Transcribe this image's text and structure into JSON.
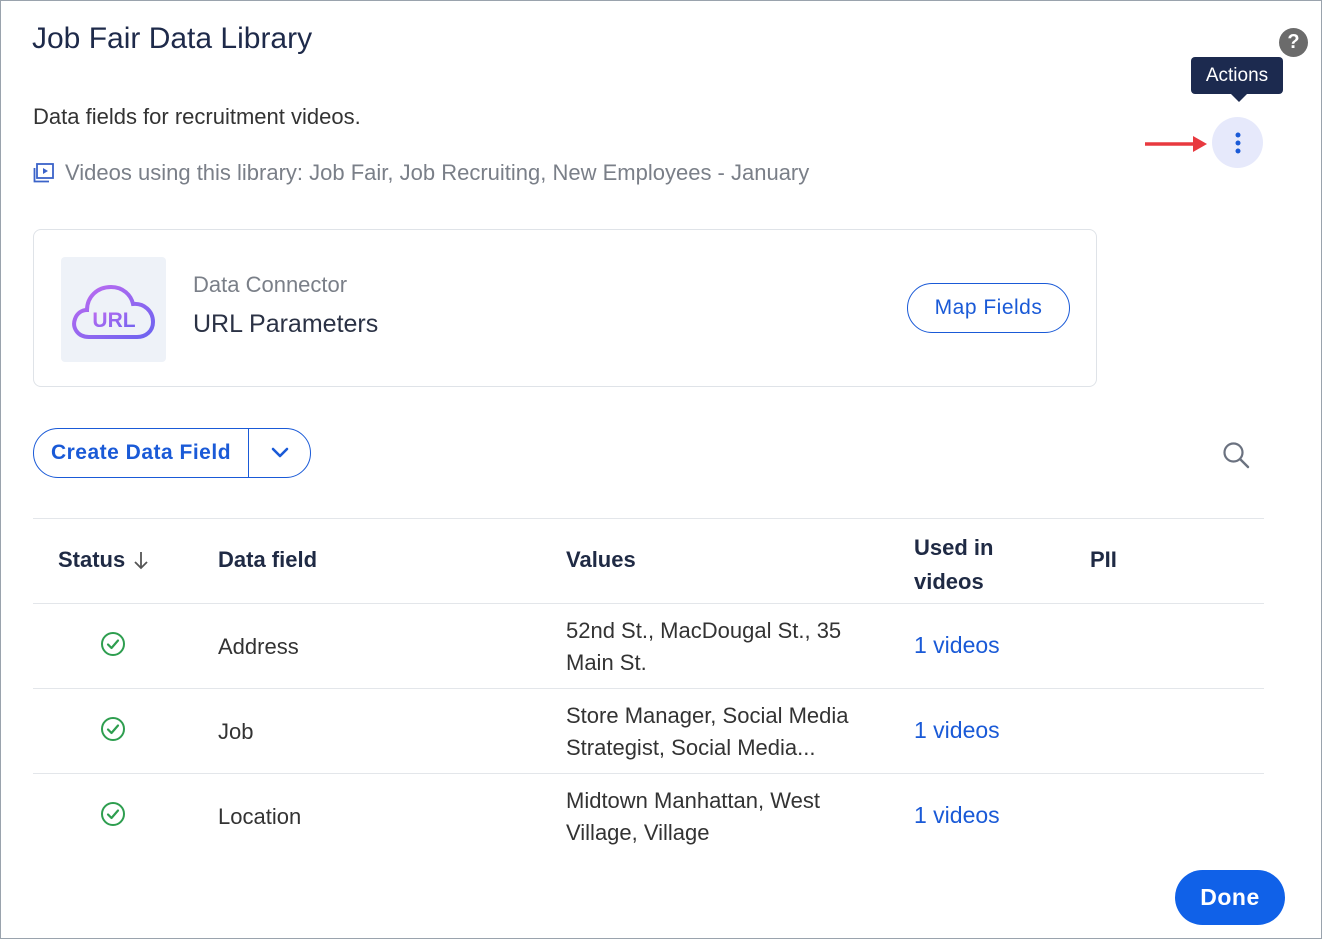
{
  "dialog": {
    "title": "Job Fair Data Library",
    "description": "Data fields for recruitment videos.",
    "videos_using": "Videos using this library: Job Fair, Job Recruiting, New Employees - January"
  },
  "help": {
    "glyph": "?"
  },
  "actions": {
    "tooltip": "Actions"
  },
  "connector": {
    "label": "Data Connector",
    "name": "URL Parameters",
    "logo_text": "URL",
    "map_fields_label": "Map Fields"
  },
  "toolbar": {
    "create_label": "Create Data Field"
  },
  "table": {
    "headers": {
      "status": "Status",
      "data_field": "Data field",
      "values": "Values",
      "used_in_line1": "Used in",
      "used_in_line2": "videos",
      "pii": "PII"
    },
    "rows": [
      {
        "field": "Address",
        "values": "52nd St., MacDougal St., 35 Main St.",
        "used_in": "1 videos"
      },
      {
        "field": "Job",
        "values": "Store Manager, Social Media Strategist, Social Media...",
        "used_in": "1 videos"
      },
      {
        "field": "Location",
        "values": "Midtown Manhattan, West Village, Village",
        "used_in": "1 videos"
      }
    ]
  },
  "footer": {
    "done_label": "Done"
  },
  "colors": {
    "accent": "#1a5ad7",
    "done": "#1061e8",
    "success": "#2e9e4f",
    "tooltip_bg": "#1c2a4f"
  }
}
